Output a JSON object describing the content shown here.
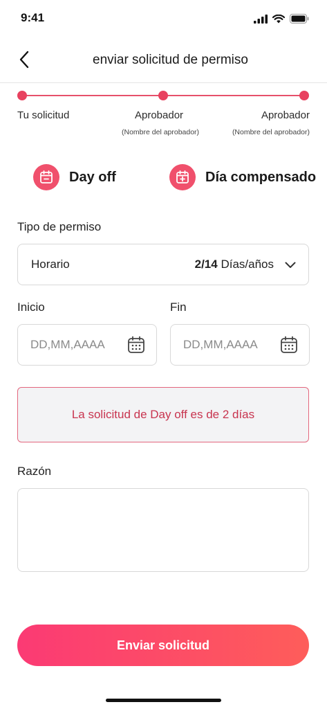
{
  "status_bar": {
    "time": "9:41",
    "icons": [
      "signal-icon",
      "wifi-icon",
      "battery-icon"
    ]
  },
  "header": {
    "back_icon": "chevron-left-icon",
    "title": "enviar solicitud de permiso"
  },
  "stepper": {
    "steps": [
      {
        "label": "Tu solicitud",
        "sub": ""
      },
      {
        "label": "Aprobador",
        "sub": "(Nombre del aprobador)"
      },
      {
        "label": "Aprobador",
        "sub": "(Nombre del aprobador)"
      }
    ]
  },
  "leave_types": [
    {
      "label": "Day off",
      "icon": "calendar-minus-icon"
    },
    {
      "label": "Día compensado",
      "icon": "calendar-plus-icon"
    }
  ],
  "permission_type": {
    "label": "Tipo de permiso",
    "value": "Horario",
    "count": "2/14",
    "unit": "Días/años"
  },
  "dates": {
    "start_label": "Inicio",
    "end_label": "Fin",
    "start_placeholder": "DD,MM,AAAA",
    "end_placeholder": "DD,MM,AAAA"
  },
  "alert": {
    "text": "La solicitud de Day off es de 2 días"
  },
  "reason": {
    "label": "Razón",
    "value": ""
  },
  "submit": {
    "label": "Enviar solicitud"
  },
  "colors": {
    "accent": "#e8415f",
    "button_gradient_start": "#fb3a74",
    "button_gradient_end": "#fe5d5a",
    "alert_text": "#c8344f"
  }
}
